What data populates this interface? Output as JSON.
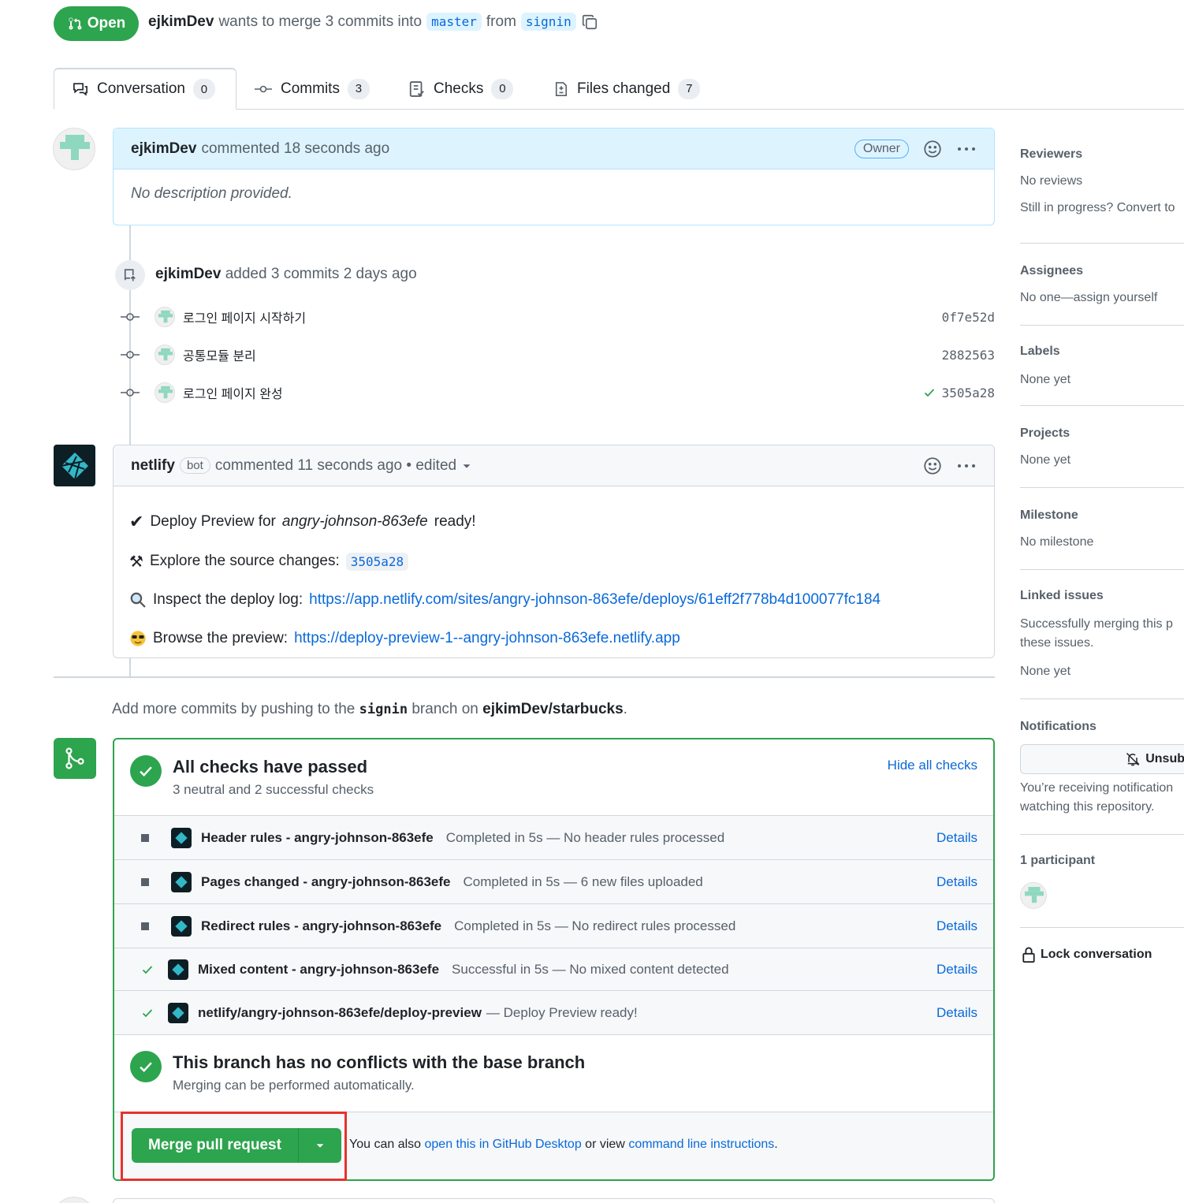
{
  "header": {
    "state": "Open",
    "author": "ejkimDev",
    "merge_text": "wants to merge 3 commits into",
    "base_branch": "master",
    "from_text": "from",
    "head_branch": "signin"
  },
  "tabs": [
    {
      "label": "Conversation",
      "count": "0"
    },
    {
      "label": "Commits",
      "count": "3"
    },
    {
      "label": "Checks",
      "count": "0"
    },
    {
      "label": "Files changed",
      "count": "7"
    }
  ],
  "first_comment": {
    "author": "ejkimDev",
    "action": "commented 18 seconds ago",
    "role": "Owner",
    "body": "No description provided."
  },
  "commits_event": {
    "author": "ejkimDev",
    "text": "added 3 commits 2 days ago",
    "commits": [
      {
        "message": "로그인 페이지 시작하기",
        "sha": "0f7e52d"
      },
      {
        "message": "공통모듈 분리",
        "sha": "2882563"
      },
      {
        "message": "로그인 페이지 완성",
        "sha": "3505a28"
      }
    ]
  },
  "bot_comment": {
    "author": "netlify",
    "bot_label": "bot",
    "action": "commented 11 seconds ago • edited",
    "line1_prefix": "Deploy Preview for",
    "line1_site": "angry-johnson-863efe",
    "line1_suffix": "ready!",
    "line2_prefix": "Explore the source changes:",
    "line2_sha": "3505a28",
    "line3_prefix": "Inspect the deploy log:",
    "line3_link": "https://app.netlify.com/sites/angry-johnson-863efe/deploys/61eff2f778b4d100077fc184",
    "line4_prefix": "Browse the preview:",
    "line4_link": "https://deploy-preview-1--angry-johnson-863efe.netlify.app"
  },
  "push_hint": {
    "prefix": "Add more commits by pushing to the",
    "branch": "signin",
    "middle": "branch on",
    "repo": "ejkimDev/starbucks",
    "suffix": "."
  },
  "checks": {
    "title": "All checks have passed",
    "subtitle": "3 neutral and 2 successful checks",
    "hide_label": "Hide all checks",
    "details_label": "Details",
    "items": [
      {
        "status": "neutral",
        "name": "Header rules - angry-johnson-863efe",
        "desc": "Completed in 5s — No header rules processed"
      },
      {
        "status": "neutral",
        "name": "Pages changed - angry-johnson-863efe",
        "desc": "Completed in 5s — 6 new files uploaded"
      },
      {
        "status": "neutral",
        "name": "Redirect rules - angry-johnson-863efe",
        "desc": "Completed in 5s — No redirect rules processed"
      },
      {
        "status": "success",
        "name": "Mixed content - angry-johnson-863efe",
        "desc": "Successful in 5s — No mixed content detected"
      },
      {
        "status": "success",
        "name": "netlify/angry-johnson-863efe/deploy-preview",
        "desc": "— Deploy Preview ready!"
      }
    ]
  },
  "conflicts": {
    "title": "This branch has no conflicts with the base branch",
    "subtitle": "Merging can be performed automatically."
  },
  "merge": {
    "button_label": "Merge pull request",
    "also_prefix": "You can also",
    "desktop_link": "open this in GitHub Desktop",
    "or_view": "or view",
    "cli_link": "command line instructions",
    "suffix": "."
  },
  "sidebar": {
    "reviewers_title": "Reviewers",
    "reviewers_value": "No reviews",
    "reviewers_hint": "Still in progress? Convert to",
    "assignees_title": "Assignees",
    "assignees_value": "No one—assign yourself",
    "labels_title": "Labels",
    "labels_value": "None yet",
    "projects_title": "Projects",
    "projects_value": "None yet",
    "milestone_title": "Milestone",
    "milestone_value": "No milestone",
    "linked_title": "Linked issues",
    "linked_text1": "Successfully merging this p",
    "linked_text2": "these issues.",
    "linked_value": "None yet",
    "notifications_title": "Notifications",
    "unsubscribe_label": "Unsub",
    "notif_text1": "You’re receiving notification",
    "notif_text2": "watching this repository.",
    "participants_title": "1 participant",
    "lock_label": "Lock conversation"
  },
  "colors": {
    "green": "#2da44e",
    "blue": "#0969da",
    "highlight": "#e5322d"
  }
}
